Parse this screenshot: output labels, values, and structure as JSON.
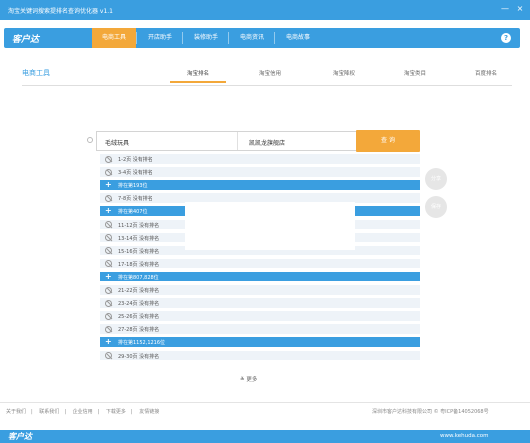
{
  "window": {
    "title": "淘宝关键词搜索提排名查询优化器 v1.1",
    "minimize_glyph": "—",
    "close_glyph": "×"
  },
  "nav": {
    "logo": "客户达",
    "tabs": [
      {
        "label": "电商工具",
        "active": true
      },
      {
        "label": "开店助手",
        "active": false
      },
      {
        "label": "装修助手",
        "active": false
      },
      {
        "label": "电商资讯",
        "active": false
      },
      {
        "label": "电商故事",
        "active": false
      }
    ],
    "help_icon": "question-icon",
    "help_glyph": "?"
  },
  "section": {
    "title": "电商工具",
    "subtabs": [
      {
        "label": "淘宝排名",
        "active": true
      },
      {
        "label": "淘宝信用",
        "active": false
      },
      {
        "label": "淘宝降权",
        "active": false
      },
      {
        "label": "淘宝类目",
        "active": false
      },
      {
        "label": "百度排名",
        "active": false
      }
    ]
  },
  "search": {
    "keyword_value": "毛绒玩具",
    "shop_value": "凯凯龙旗舰店",
    "query_button": "查 询"
  },
  "side_buttons": {
    "top": "分享",
    "bottom": "保存"
  },
  "results": [
    {
      "text": "1-2页 没有排名",
      "hit": false
    },
    {
      "text": "3-4页 没有排名",
      "hit": false
    },
    {
      "text": "排在第193位",
      "hit": true
    },
    {
      "text": "7-8页 没有排名",
      "hit": false
    },
    {
      "text": "排在第407位",
      "hit": true
    },
    {
      "text": "11-12页 没有排名",
      "hit": false
    },
    {
      "text": "13-14页 没有排名",
      "hit": false
    },
    {
      "text": "15-16页 没有排名",
      "hit": false
    },
    {
      "text": "17-18页 没有排名",
      "hit": false
    },
    {
      "text": "排在第807,828位",
      "hit": true
    },
    {
      "text": "21-22页 没有排名",
      "hit": false
    },
    {
      "text": "23-24页 没有排名",
      "hit": false
    },
    {
      "text": "25-26页 没有排名",
      "hit": false
    },
    {
      "text": "27-28页 没有排名",
      "hit": false
    },
    {
      "text": "排在第1152,1216位",
      "hit": true
    },
    {
      "text": "29-30页 没有排名",
      "hit": false
    }
  ],
  "more": {
    "label": "更多",
    "icon": "double-chevron-down-icon",
    "glyph": "≚"
  },
  "footer": {
    "links": [
      "关于我们",
      "联系我们",
      "企业信用",
      "下载更多",
      "友情链接"
    ],
    "copyright": "深圳市客户达科技有限公司 © 粤ICP备14052068号"
  },
  "bottombar": {
    "logo": "客户达",
    "url": "www.kehuda.com"
  },
  "colors": {
    "primary": "#3a9ee0",
    "accent": "#f3a83a",
    "row_bg": "#eef3f8"
  }
}
